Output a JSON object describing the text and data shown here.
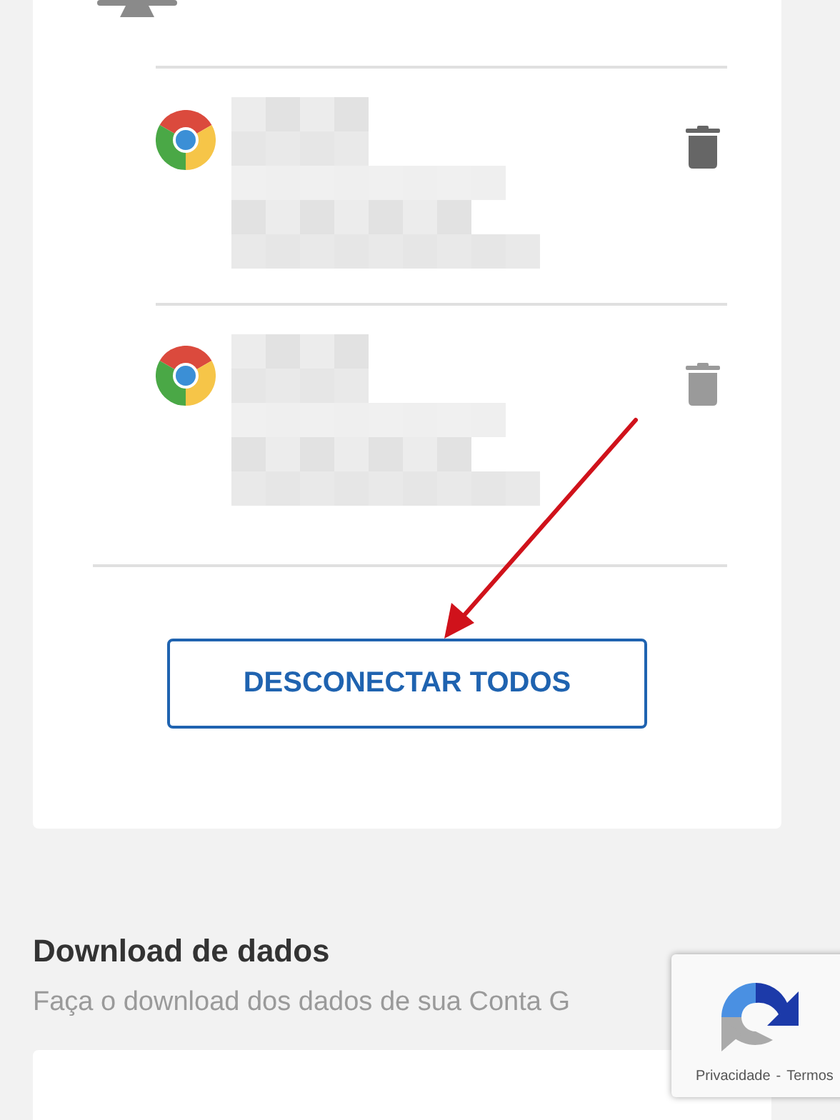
{
  "devices": [
    {
      "disabled": false
    },
    {
      "disabled": true
    }
  ],
  "disconnect_button": "DESCONECTAR TODOS",
  "section": {
    "title": "Download de dados",
    "subtitle": "Faça o download dos dados de sua Conta G"
  },
  "recaptcha": {
    "links": [
      "Privacidade",
      "Termos"
    ],
    "separator": "-"
  }
}
